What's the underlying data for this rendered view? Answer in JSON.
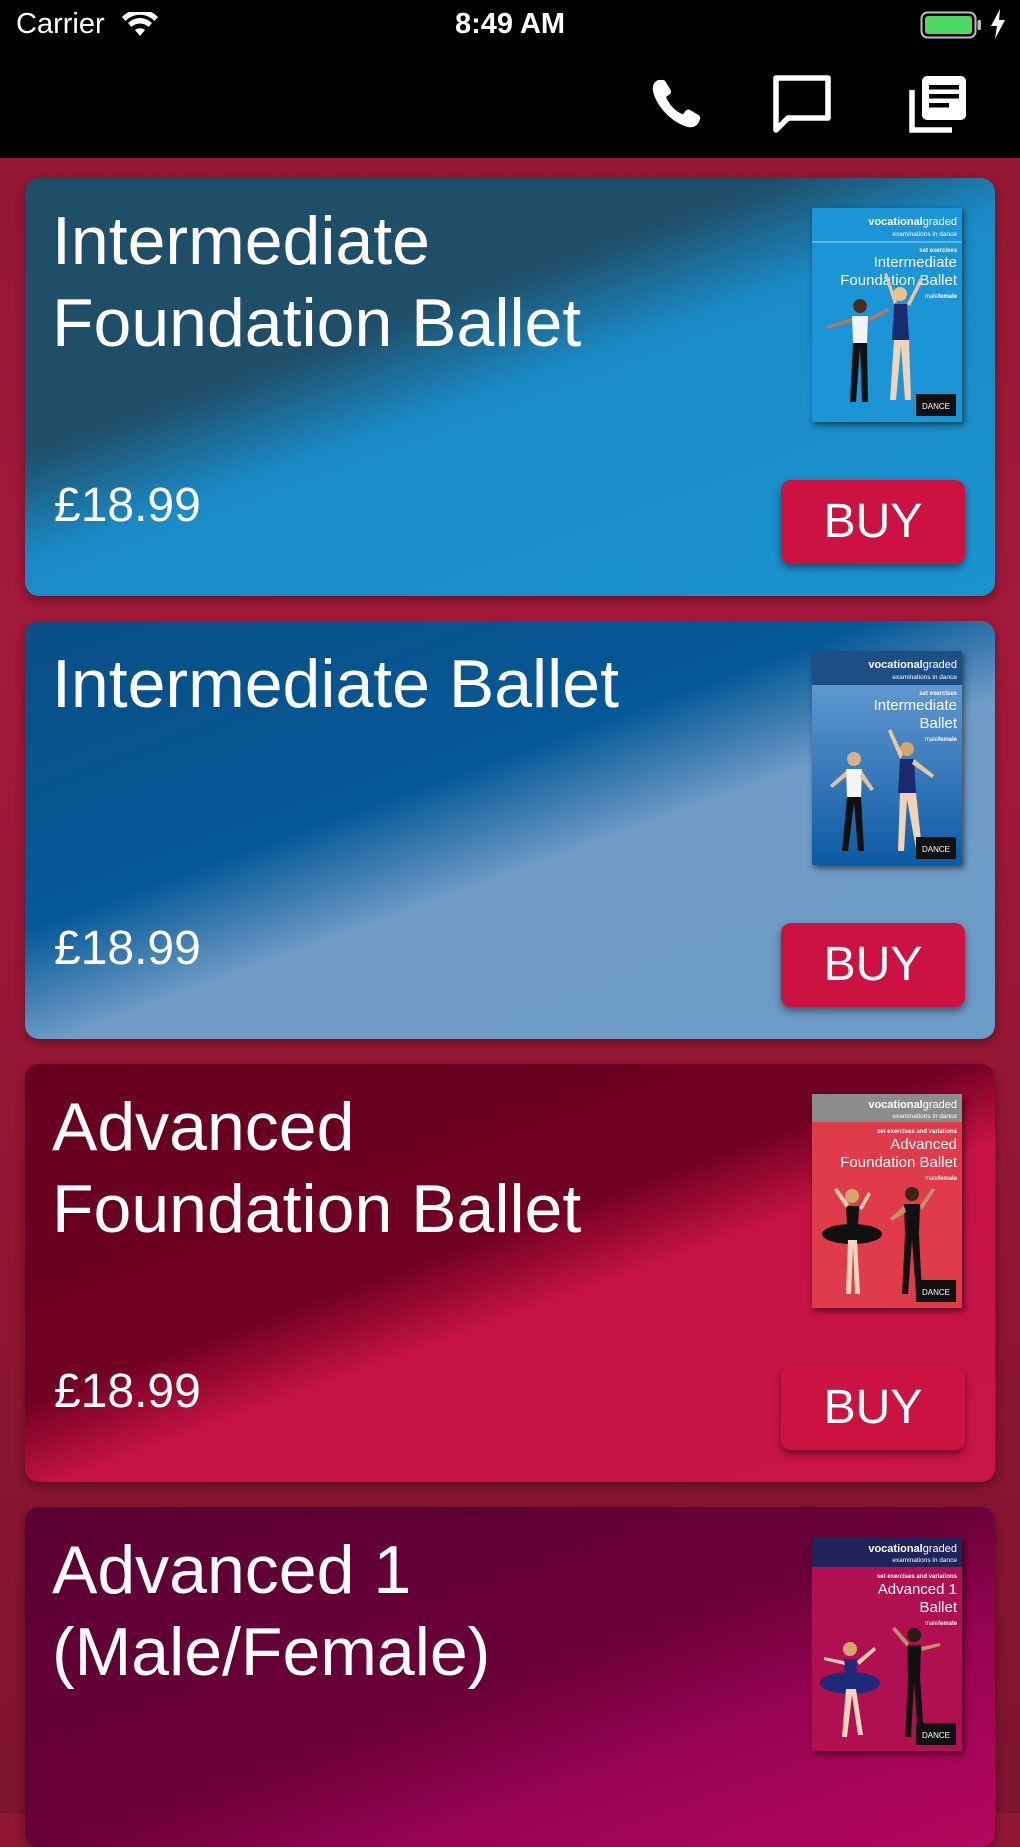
{
  "status_bar": {
    "carrier": "Carrier",
    "time": "8:49 AM"
  },
  "nav_bar": {
    "icons": [
      "phone-icon",
      "chat-icon",
      "document-list-icon"
    ]
  },
  "products": [
    {
      "title_line1": "Intermediate",
      "title_line2": "Foundation Ballet",
      "price": "£18.99",
      "buy_label": "BUY",
      "cover": {
        "brand_bold": "vocational",
        "brand_light": "graded",
        "tagline": "examinations in dance",
        "kicker": "set exercises",
        "title_line1": "Intermediate",
        "title_line2": "Foundation Ballet",
        "gender": "male",
        "gender_b": "female",
        "badge": "DANCE",
        "color": "#1c95d6",
        "header_color": "#1c95d6"
      }
    },
    {
      "title_line1": "Intermediate Ballet",
      "title_line2": "",
      "price": "£18.99",
      "buy_label": "BUY",
      "cover": {
        "brand_bold": "vocational",
        "brand_light": "graded",
        "tagline": "examinations in dance",
        "kicker": "set exercises",
        "title_line1": "Intermediate",
        "title_line2": "Ballet",
        "gender": "male",
        "gender_b": "female",
        "badge": "DANCE",
        "color": "#3a7fc4",
        "header_color": "#1d4f86"
      }
    },
    {
      "title_line1": "Advanced",
      "title_line2": "Foundation Ballet",
      "price": "£18.99",
      "buy_label": "BUY",
      "cover": {
        "brand_bold": "vocational",
        "brand_light": "graded",
        "tagline": "examinations in dance",
        "kicker": "set exercises and variations",
        "title_line1": "Advanced",
        "title_line2": "Foundation Ballet",
        "gender": "male",
        "gender_b": "female",
        "badge": "DANCE",
        "color": "#e03b4a",
        "header_color": "#8c8c8c"
      }
    },
    {
      "title_line1": "Advanced 1",
      "title_line2": "(Male/Female)",
      "price": "",
      "buy_label": "",
      "cover": {
        "brand_bold": "vocational",
        "brand_light": "graded",
        "tagline": "examinations in dance",
        "kicker": "set exercises and variations",
        "title_line1": "Advanced 1",
        "title_line2": "Ballet",
        "gender": "male",
        "gender_b": "female",
        "badge": "DANCE",
        "color": "#b0104f",
        "header_color": "#20245a"
      }
    }
  ]
}
